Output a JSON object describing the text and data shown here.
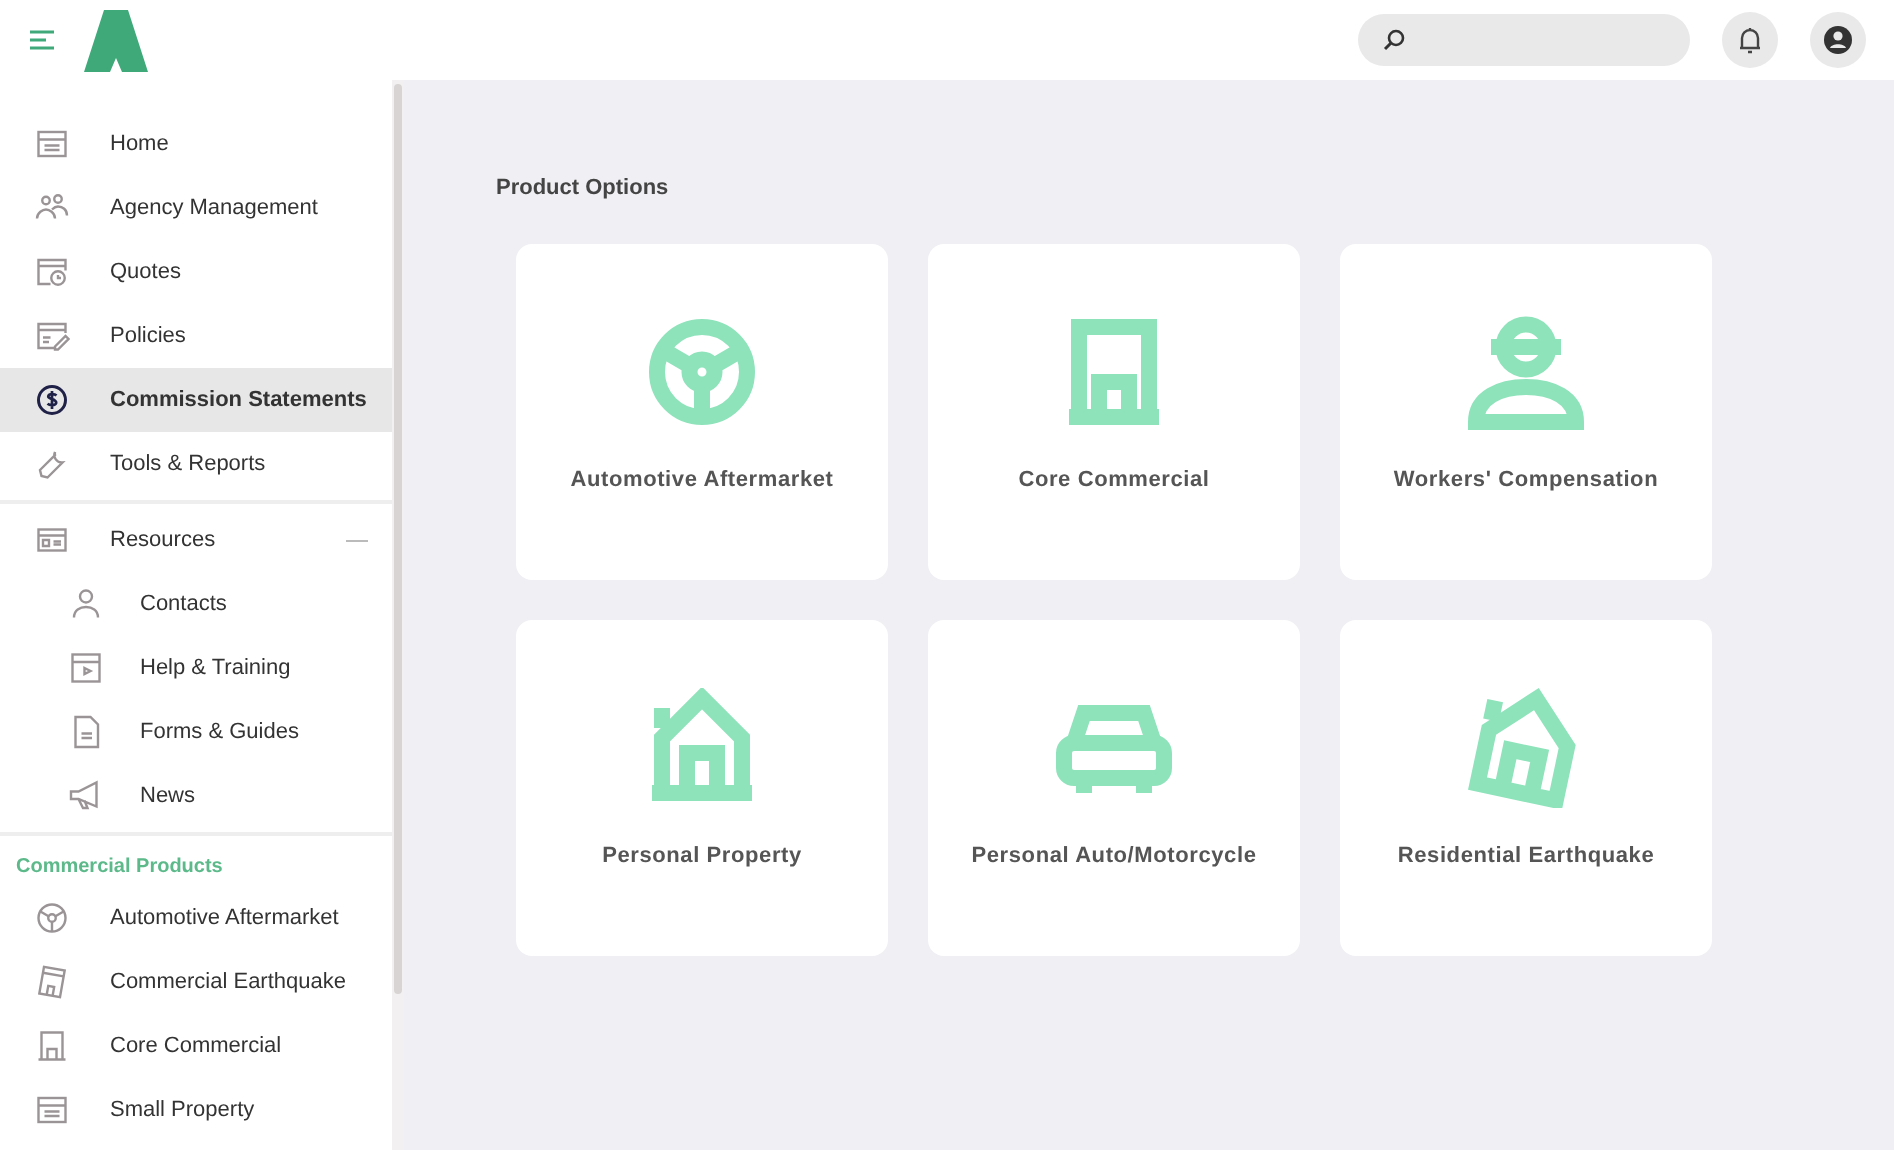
{
  "sidebar": {
    "items": [
      {
        "label": "Home",
        "kind": "calendar",
        "selected": false
      },
      {
        "label": "Agency Management",
        "kind": "people",
        "selected": false
      },
      {
        "label": "Quotes",
        "kind": "clock",
        "selected": false
      },
      {
        "label": "Policies",
        "kind": "edit",
        "selected": false
      },
      {
        "label": "Commission Statements",
        "kind": "dollar",
        "selected": true
      },
      {
        "label": "Tools & Reports",
        "kind": "wrench",
        "selected": false
      }
    ],
    "groups": [
      {
        "label": "Resources",
        "kind": "card",
        "expanded": true,
        "children": [
          {
            "label": "Contacts",
            "kind": "person",
            "selected": false
          },
          {
            "label": "Help & Training",
            "kind": "video",
            "selected": false
          },
          {
            "label": "Forms & Guides",
            "kind": "doc",
            "selected": false
          },
          {
            "label": "News",
            "kind": "megaphone",
            "selected": false
          }
        ]
      }
    ],
    "section": {
      "title": "Commercial Products",
      "items": [
        {
          "label": "Automotive Aftermarket",
          "kind": "wheel",
          "selected": false
        },
        {
          "label": "Commercial Earthquake",
          "kind": "tilt",
          "selected": false
        },
        {
          "label": "Core Commercial",
          "kind": "building",
          "selected": false
        },
        {
          "label": "Small Property",
          "kind": "calendar",
          "selected": false
        }
      ]
    }
  },
  "main": {
    "title": "Product Options",
    "cards": [
      {
        "label": "Automotive Aftermarket",
        "kind": "wheel"
      },
      {
        "label": "Core Commercial",
        "kind": "building"
      },
      {
        "label": "Workers' Compensation",
        "kind": "worker"
      },
      {
        "label": "Personal Property",
        "kind": "house"
      },
      {
        "label": "Personal Auto/Motorcycle",
        "kind": "car"
      },
      {
        "label": "Residential Earthquake",
        "kind": "tilthouse"
      }
    ]
  }
}
